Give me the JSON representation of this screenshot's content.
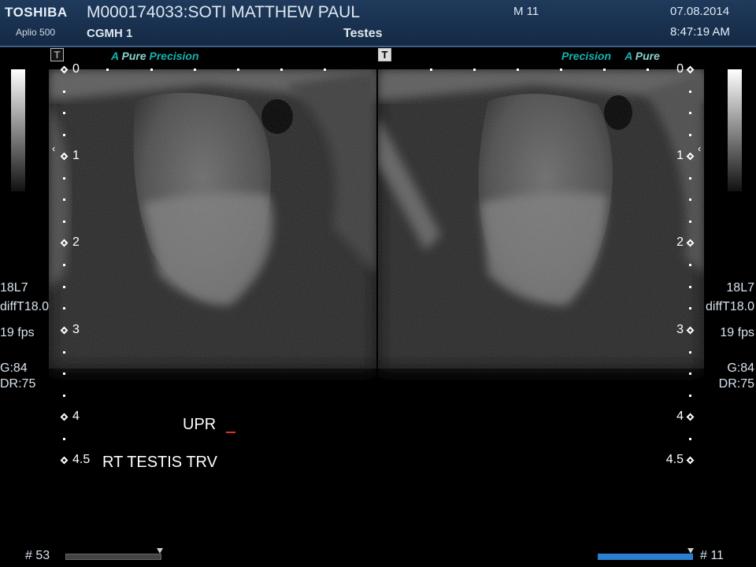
{
  "header": {
    "brand": "TOSHIBA",
    "model": "Aplio 500",
    "patient": "M000174033:SOTI MATTHEW PAUL",
    "hospital": "CGMH 1",
    "preset": "Testes",
    "modality": "M 11",
    "date": "07.08.2014",
    "time": "8:47:19 AM"
  },
  "panels": {
    "left": {
      "indicator": "T",
      "mode_a": "A",
      "mode_pure": "Pure",
      "mode_precision": "Precision"
    },
    "right": {
      "indicator": "T",
      "mode_precision": "Precision",
      "mode_a": "A",
      "mode_pure": "Pure"
    }
  },
  "depth_labels": [
    "0",
    "1",
    "2",
    "3",
    "4",
    "4.5"
  ],
  "focus_caret": "‹",
  "params": {
    "probe": "18L7",
    "filter": "diffT18.0",
    "frame_rate": "19 fps",
    "gain": "G:84",
    "dynamic_range": "DR:75"
  },
  "annotations": {
    "upr": "UPR",
    "label": "RT TESTIS TRV"
  },
  "cine": {
    "left_counter": "# 53",
    "right_counter": "# 11"
  },
  "colors": {
    "header": "#1f3a5c",
    "accent": "#18b0b0",
    "cine_active": "#2a7fd0",
    "cursor": "#e03030"
  }
}
